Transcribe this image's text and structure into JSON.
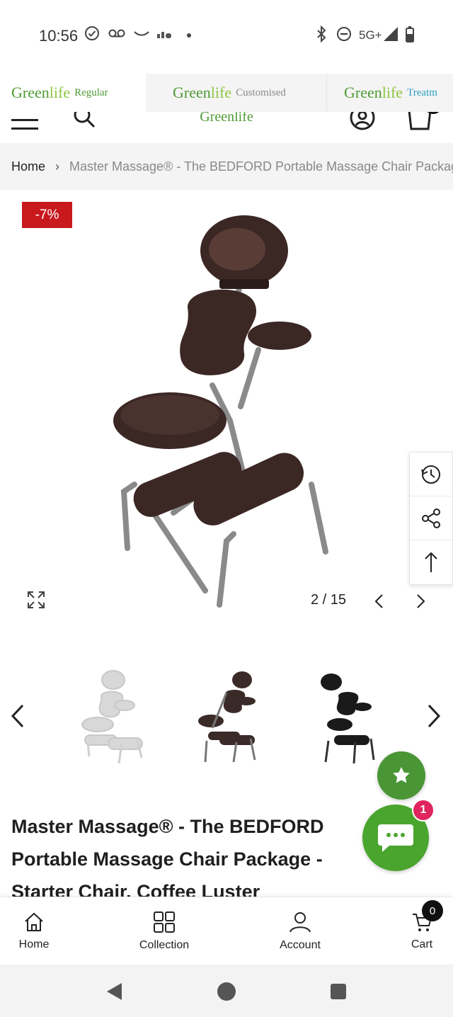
{
  "status_bar": {
    "time": "10:56",
    "network": "5G+"
  },
  "header": {
    "brand_tabs": [
      {
        "brand_a": "Green",
        "brand_b": "life",
        "suffix": "Regular"
      },
      {
        "brand_a": "Green",
        "brand_b": "life",
        "suffix": "Customised"
      },
      {
        "brand_a": "Green",
        "brand_b": "life",
        "suffix": "Treatm"
      }
    ],
    "logo": "Greenlife",
    "icons": [
      "menu-icon",
      "search-icon",
      "account-icon",
      "cart-icon"
    ]
  },
  "breadcrumb": {
    "home": "Home",
    "separator": "›",
    "current": "Master Massage® - The BEDFORD Portable Massage Chair Package - Starter Chair, Coffee Luster"
  },
  "gallery": {
    "discount_badge": "-7%",
    "counter": "2 / 15",
    "side_tools": [
      "recently-viewed-icon",
      "share-icon",
      "back-to-top-icon"
    ]
  },
  "thumbnails": {
    "count_visible": 3,
    "selected_index": 1
  },
  "product": {
    "title": "Master Massage® - The BEDFORD Portable Massage Chair Package - Starter Chair, Coffee Luster"
  },
  "chat": {
    "badge": "1"
  },
  "bottom_nav": {
    "items": [
      {
        "label": "Home",
        "icon": "home-icon"
      },
      {
        "label": "Collection",
        "icon": "grid-icon"
      },
      {
        "label": "Account",
        "icon": "user-icon"
      },
      {
        "label": "Cart",
        "icon": "cart-icon"
      }
    ],
    "cart_count": "0"
  },
  "colors": {
    "brand_green": "#4f9a33",
    "brand_light_green": "#8dc63f",
    "discount_red": "#c8191e",
    "chat_green": "#4aa52e",
    "badge_pink": "#e0245e"
  }
}
